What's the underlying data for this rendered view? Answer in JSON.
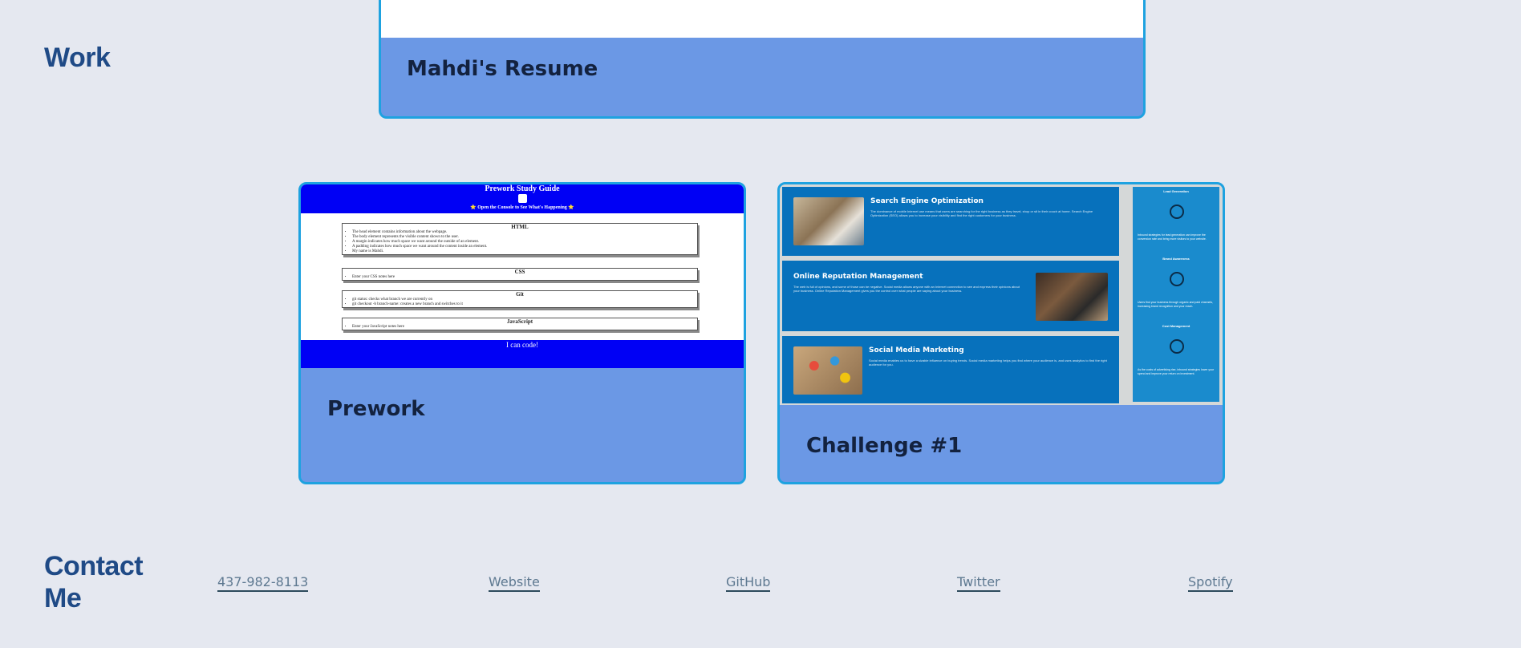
{
  "sections": {
    "work_heading": "Work",
    "contact_heading_line1": "Contact",
    "contact_heading_line2": "Me"
  },
  "projects": [
    {
      "title": "Mahdi's Resume"
    },
    {
      "title": "Prework",
      "thumbnail": {
        "header_title": "Prework Study Guide",
        "header_subtitle": "Open the Console to See What's Happening",
        "footer": "I can code!",
        "sections": [
          {
            "title": "HTML",
            "items": [
              "The head element contains information about the webpage.",
              "The body element represents the visible content shown to the user.",
              "A margin indicates how much space we want around the outside of an element.",
              "A padding indicates how much space we want around the content inside an element.",
              "My name is Mahdi."
            ]
          },
          {
            "title": "CSS",
            "items": [
              "Enter your CSS notes here"
            ]
          },
          {
            "title": "Git",
            "items": [
              "git status: checks what branch we are currently on",
              "git checkout -b branch-name: creates a new branch and switches to it"
            ]
          },
          {
            "title": "JavaScript",
            "items": [
              "Enter your JavaScript notes here"
            ]
          }
        ]
      }
    },
    {
      "title": "Challenge #1",
      "thumbnail": {
        "rows": [
          {
            "title": "Search Engine Optimization",
            "body": "The dominance of mobile Internet use means that users are searching for the right business as they travel, shop or sit in their couch at home. Search Engine Optimization (SEO) allows you to increase your visibility and find the right customers for your business."
          },
          {
            "title": "Online Reputation Management",
            "body": "The web is full of opinions, and some of those can be negative. Social media allows anyone with an Internet connection to see and express their opinions about your business. Online Reputation Management gives you the control over what people are saying about your business."
          },
          {
            "title": "Social Media Marketing",
            "body": "Social media enables us to have a sizable influence on buying trends. Social media marketing helps you find where your audience is, and uses analytics to find the right audience for you."
          }
        ],
        "side": [
          {
            "title": "Lead Generation",
            "body": "Inbound strategies for lead generation can improve the conversion rate and bring more visitors to your website."
          },
          {
            "title": "Brand Awareness",
            "body": "Users find your business through organic and paid channels, increasing brand recognition and your reach."
          },
          {
            "title": "Cost Management",
            "body": "As the costs of advertising rise, inbound strategies lower your spend and improve your return on investment."
          }
        ]
      }
    }
  ],
  "contact": {
    "phone": "437-982-8113",
    "website": "Website",
    "github": "GitHub",
    "twitter": "Twitter",
    "spotify": "Spotify"
  },
  "colors": {
    "background": "#e5e8f0",
    "heading": "#1f4a86",
    "card": "#6b98e5",
    "card_border": "#1ea2e0"
  }
}
